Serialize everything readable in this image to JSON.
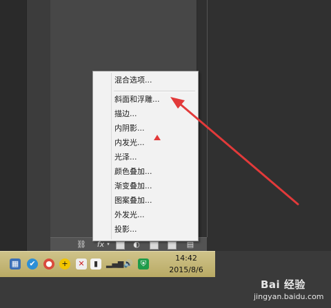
{
  "context_menu": {
    "items": [
      {
        "label": "混合选项..."
      },
      {
        "label": "斜面和浮雕..."
      },
      {
        "label": "描边..."
      },
      {
        "label": "内阴影..."
      },
      {
        "label": "内发光..."
      },
      {
        "label": "光泽..."
      },
      {
        "label": "颜色叠加..."
      },
      {
        "label": "渐变叠加..."
      },
      {
        "label": "图案叠加..."
      },
      {
        "label": "外发光..."
      },
      {
        "label": "投影..."
      }
    ]
  },
  "layers_bar": {
    "fx_label": "fx"
  },
  "taskbar": {
    "time": "14:42",
    "date": "2015/8/6"
  },
  "watermark": {
    "logo": "Bai 经验",
    "url": "jingyan.baidu.com"
  },
  "colors": {
    "arrow": "#e23a3a",
    "taskbar": "#c4b673",
    "menu_bg": "#f2f2f2"
  }
}
